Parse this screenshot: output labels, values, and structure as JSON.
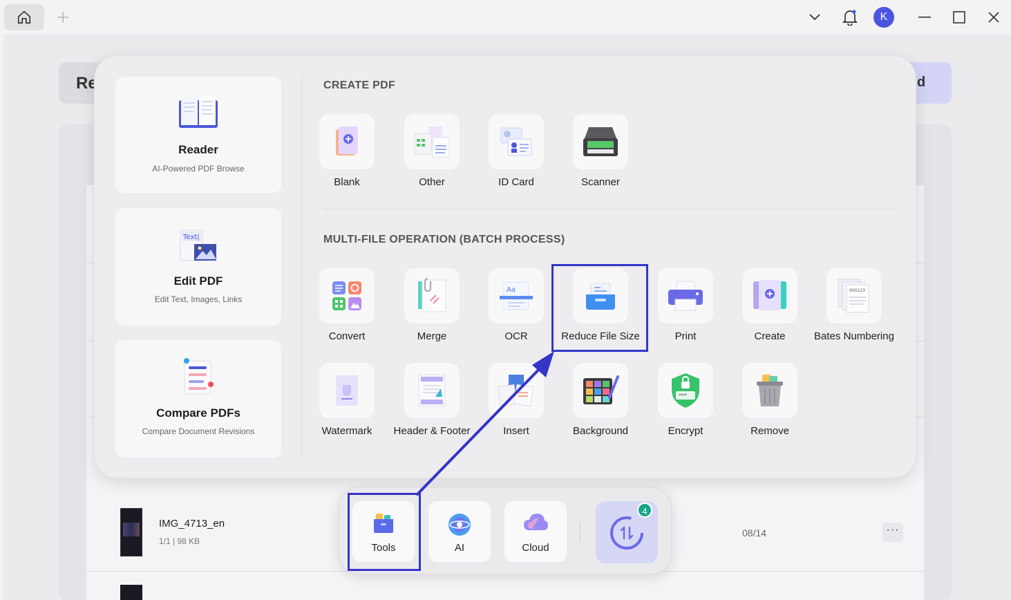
{
  "titlebar": {
    "user_initial": "K"
  },
  "background": {
    "header_left_text": "Re",
    "header_right_text": "d",
    "file": {
      "name": "IMG_4713_en",
      "meta": "1/1 | 98 KB",
      "date": "08/14",
      "more": "···"
    }
  },
  "side_cards": [
    {
      "title": "Reader",
      "subtitle": "AI-Powered PDF Browse"
    },
    {
      "title": "Edit PDF",
      "subtitle": "Edit Text, Images, Links",
      "art_text": "Text|"
    },
    {
      "title": "Compare PDFs",
      "subtitle": "Compare Document Revisions"
    }
  ],
  "create_pdf": {
    "title": "CREATE PDF",
    "tools": [
      {
        "label": "Blank",
        "icon": "blank-pdf-icon"
      },
      {
        "label": "Other",
        "icon": "other-format-icon"
      },
      {
        "label": "ID Card",
        "icon": "id-card-icon"
      },
      {
        "label": "Scanner",
        "icon": "scanner-icon"
      }
    ]
  },
  "batch": {
    "title": "MULTI-FILE OPERATION (BATCH PROCESS)",
    "tools": [
      {
        "label": "Convert",
        "icon": "convert-icon"
      },
      {
        "label": "Merge",
        "icon": "merge-icon"
      },
      {
        "label": "OCR",
        "icon": "ocr-icon",
        "icon_text": "Aa"
      },
      {
        "label": "Reduce File Size",
        "icon": "compress-icon"
      },
      {
        "label": "Print",
        "icon": "print-icon"
      },
      {
        "label": "Create",
        "icon": "create-icon"
      },
      {
        "label": "Bates Numbering",
        "icon": "bates-numbering-icon",
        "icon_text": "000123"
      },
      {
        "label": "Watermark",
        "icon": "watermark-icon"
      },
      {
        "label": "Header & Footer",
        "icon": "header-footer-icon"
      },
      {
        "label": "Insert",
        "icon": "insert-icon"
      },
      {
        "label": "Background",
        "icon": "background-icon"
      },
      {
        "label": "Encrypt",
        "icon": "encrypt-icon",
        "icon_text": "***"
      },
      {
        "label": "Remove",
        "icon": "trash-icon"
      }
    ]
  },
  "dock": {
    "tools_label": "Tools",
    "ai_label": "AI",
    "cloud_label": "Cloud",
    "badge_count": "4"
  },
  "colors": {
    "accent": "#4a55e0",
    "highlight": "#3535c8",
    "badge": "#17a689"
  }
}
